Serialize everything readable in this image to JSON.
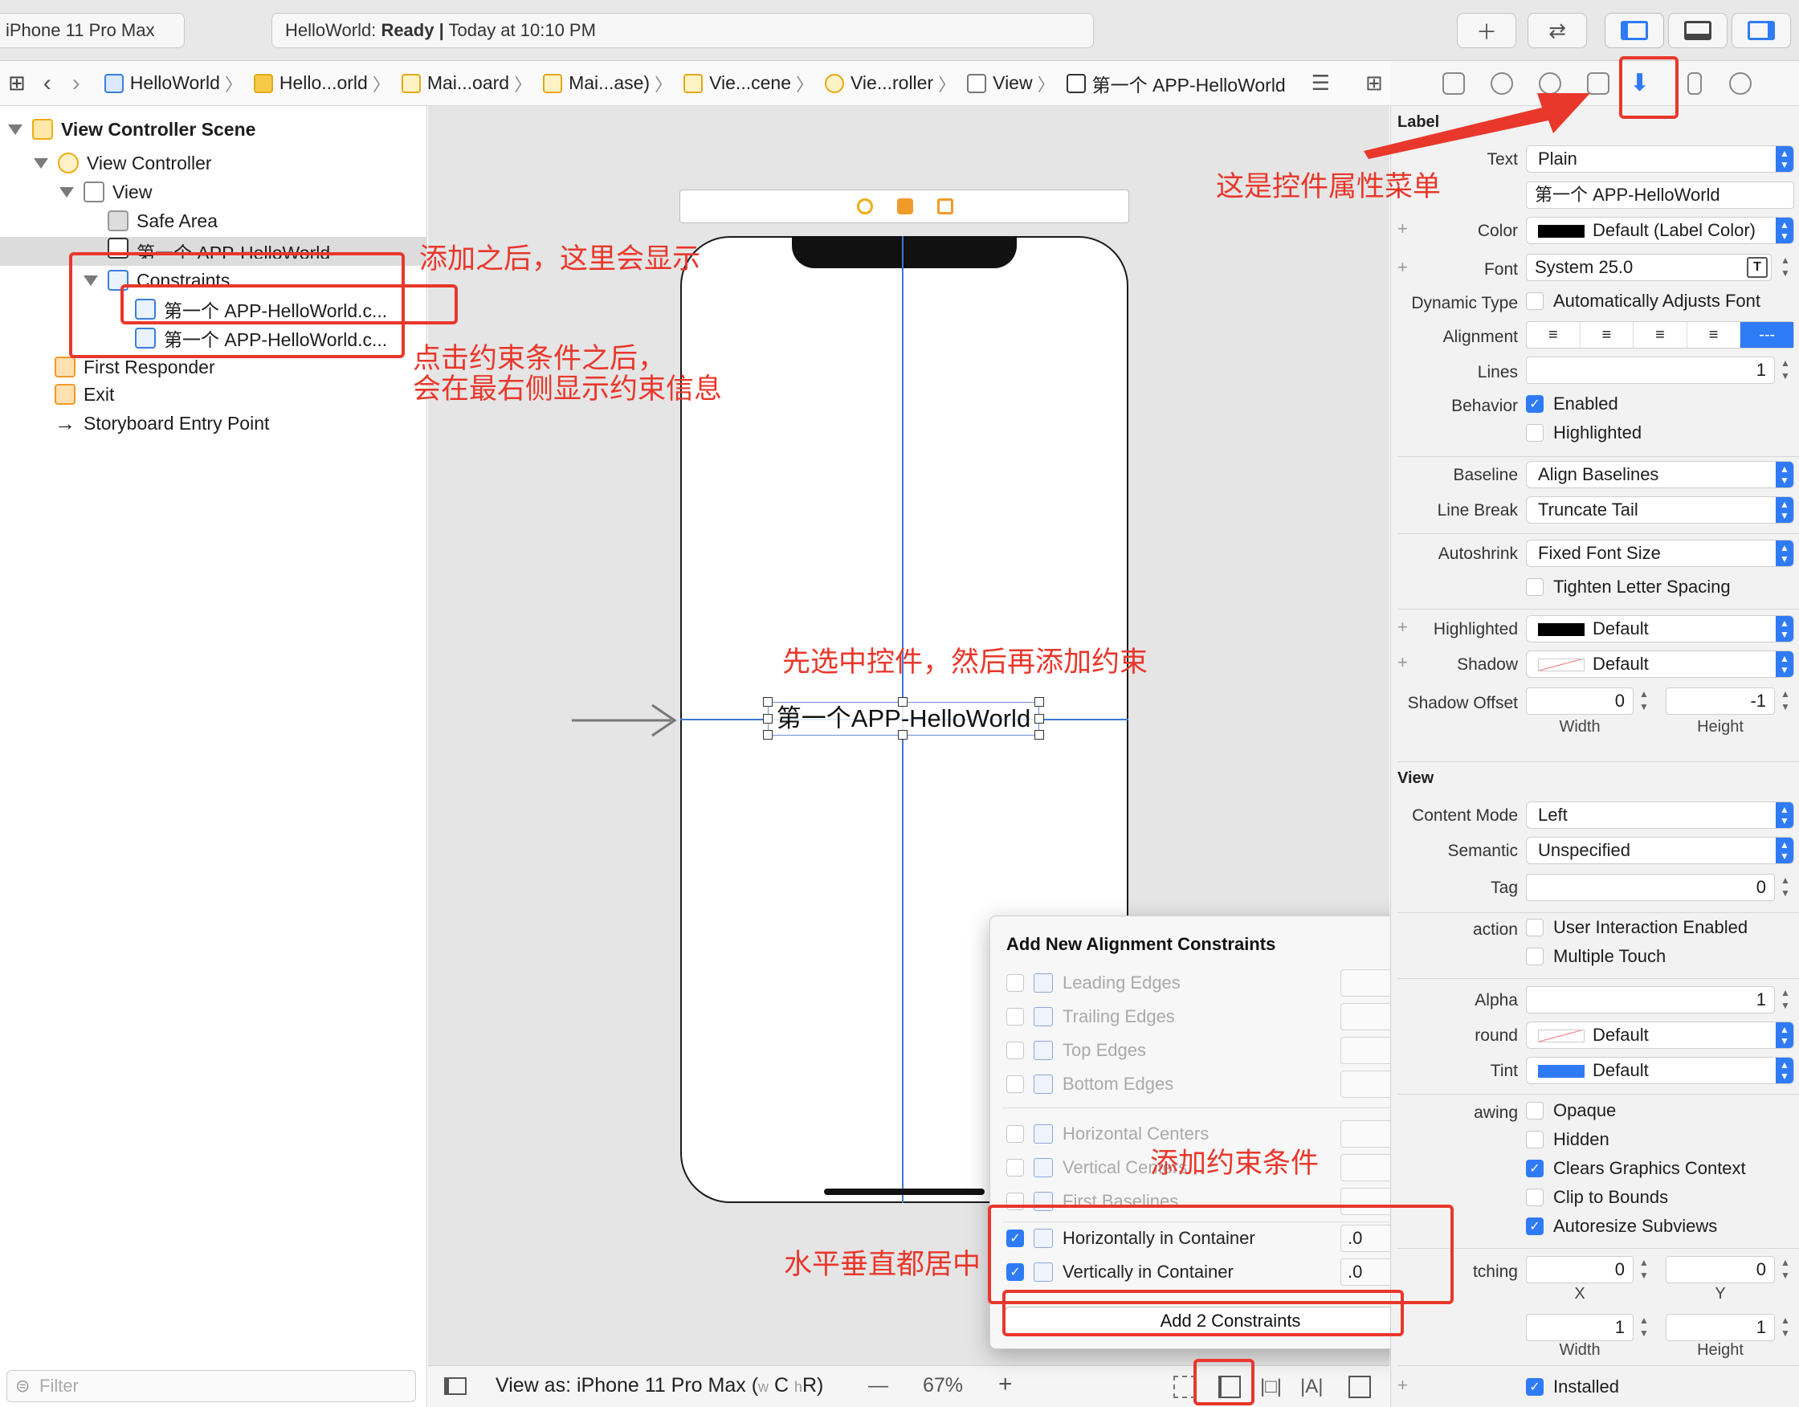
{
  "toolbar": {
    "device": "iPhone 11 Pro Max",
    "status_app": "HelloWorld:",
    "status_state": "Ready",
    "status_sep": "|",
    "status_time": "Today at 10:10 PM",
    "add_icon": "plus-icon",
    "swap_icon": "swap-arrows-icon"
  },
  "jumpbar": {
    "crumbs": [
      "HelloWorld",
      "Hello...orld",
      "Mai...oard",
      "Mai...ase)",
      "Vie...cene",
      "Vie...roller",
      "View",
      "第一个 APP-HelloWorld"
    ]
  },
  "navigator": {
    "scene": "View Controller Scene",
    "view_controller": "View Controller",
    "view": "View",
    "safe_area": "Safe Area",
    "label_item": "第一个 APP-HelloWorld",
    "constraints": "Constraints",
    "constraint_1": "第一个 APP-HelloWorld.c...",
    "constraint_2": "第一个 APP-HelloWorld.c...",
    "first_responder": "First Responder",
    "exit": "Exit",
    "entry_point": "Storyboard Entry Point",
    "filter_placeholder": "Filter"
  },
  "canvas": {
    "label_text": "第一个APP-HelloWorld",
    "view_as": "View as: iPhone 11 Pro Max (",
    "size_w": "w",
    "size_c": "C",
    "size_h": "h",
    "size_r": "R)",
    "zoom": "67%",
    "zoom_out": "—",
    "zoom_in": "+"
  },
  "popover": {
    "title": "Add New Alignment Constraints",
    "rows": [
      {
        "label": "Leading Edges",
        "checked": false,
        "enabled": false,
        "value": ""
      },
      {
        "label": "Trailing Edges",
        "checked": false,
        "enabled": false,
        "value": ""
      },
      {
        "label": "Top Edges",
        "checked": false,
        "enabled": false,
        "value": ""
      },
      {
        "label": "Bottom Edges",
        "checked": false,
        "enabled": false,
        "value": ""
      },
      {
        "label": "Horizontal Centers",
        "checked": false,
        "enabled": false,
        "value": ""
      },
      {
        "label": "Vertical Centers",
        "checked": false,
        "enabled": false,
        "value": ""
      },
      {
        "label": "First Baselines",
        "checked": false,
        "enabled": false,
        "value": ""
      },
      {
        "label": "Horizontally in Container",
        "checked": true,
        "enabled": true,
        "value": ".0"
      },
      {
        "label": "Vertically in Container",
        "checked": true,
        "enabled": true,
        "value": ".0"
      }
    ],
    "add_button": "Add 2 Constraints"
  },
  "inspector": {
    "label_section": "Label",
    "text_label": "Text",
    "text_type": "Plain",
    "text_value": "第一个 APP-HelloWorld",
    "color_label": "Color",
    "color_value": "Default (Label Color)",
    "font_label": "Font",
    "font_value": "System 25.0",
    "dynamic_type_label": "Dynamic Type",
    "dynamic_type_value": "Automatically Adjusts Font",
    "alignment_label": "Alignment",
    "lines_label": "Lines",
    "lines_value": "1",
    "behavior_label": "Behavior",
    "enabled": "Enabled",
    "highlighted": "Highlighted",
    "baseline_label": "Baseline",
    "baseline_value": "Align Baselines",
    "line_break_label": "Line Break",
    "line_break_value": "Truncate Tail",
    "autoshrink_label": "Autoshrink",
    "autoshrink_value": "Fixed Font Size",
    "tighten": "Tighten Letter Spacing",
    "highlighted_label": "Highlighted",
    "highlighted_value": "Default",
    "shadow_label": "Shadow",
    "shadow_value": "Default",
    "shadow_offset_label": "Shadow Offset",
    "shadow_w": "0",
    "shadow_h": "-1",
    "width_label": "Width",
    "height_label": "Height",
    "view_section": "View",
    "content_mode_label": "Content Mode",
    "content_mode_value": "Left",
    "semantic_label": "Semantic",
    "semantic_value": "Unspecified",
    "tag_label": "Tag",
    "tag_value": "0",
    "interaction_label": "action",
    "user_interaction": "User Interaction Enabled",
    "multiple_touch": "Multiple Touch",
    "alpha_label": "Alpha",
    "alpha_value": "1",
    "background_label": "round",
    "background_value": "Default",
    "tint_label": "Tint",
    "tint_value": "Default",
    "drawing_label": "awing",
    "opaque": "Opaque",
    "hidden": "Hidden",
    "clears": "Clears Graphics Context",
    "clip": "Clip to Bounds",
    "autoresize": "Autoresize Subviews",
    "stretching_label": "tching",
    "stretch_x": "0",
    "stretch_y": "0",
    "x_label": "X",
    "y_label": "Y",
    "stretch_w": "1",
    "stretch_h": "1",
    "installed": "Installed"
  },
  "annotations": {
    "menu_note": "这是控件属性菜单",
    "added_note": "添加之后，这里会显示",
    "click_note_1": "点击约束条件之后，",
    "click_note_2": "会在最右侧显示约束信息",
    "select_note": "先选中控件，然后再添加约束",
    "add_note": "添加约束条件",
    "center_note": "水平垂直都居中"
  },
  "colors": {
    "accent": "#2f7bf5",
    "annotation": "#e9372b"
  }
}
